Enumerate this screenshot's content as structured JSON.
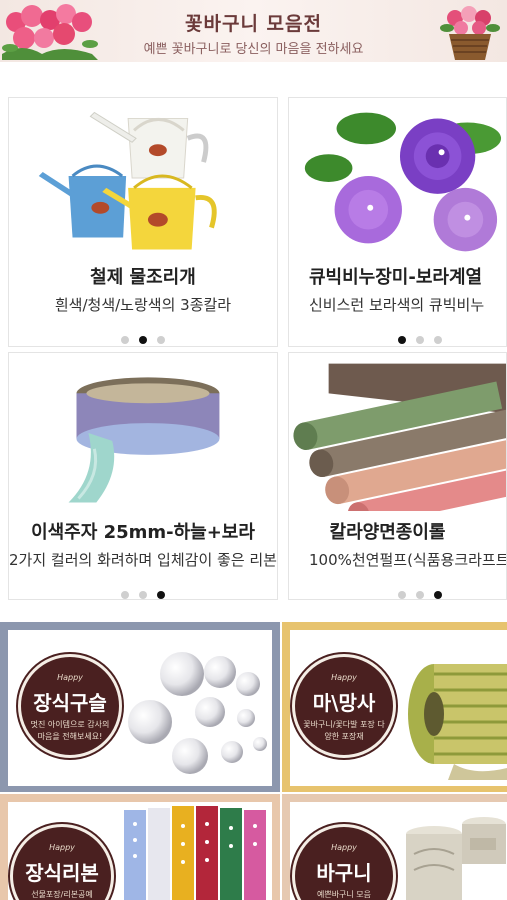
{
  "banner": {
    "title": "꽃바구니 모음전",
    "subtitle": "예쁜 꽃바구니로 당신의 마음을 전하세요"
  },
  "products": [
    {
      "title": "철제 물조리개",
      "desc": "흰색/청색/노랑색의 3종칼라",
      "active_dot": 2,
      "dot_count": 3
    },
    {
      "title": "큐빅비누장미-보라계열",
      "desc": "신비스런 보라색의 큐빅비누",
      "active_dot": 1,
      "dot_count": 3
    },
    {
      "title": "이색주자 25mm-하늘+보라",
      "desc": "2가지 컬러의 화려하며 입체감이 좋은 리본",
      "active_dot": 3,
      "dot_count": 3
    },
    {
      "title": "칼라양면종이롤",
      "desc": "100%천연펄프(식품용크라프트",
      "active_dot": 3,
      "dot_count": 3
    }
  ],
  "categories": [
    {
      "happy": "Happy",
      "title": "장식구슬",
      "desc": "멋진 아이템으로 감사의 마음을 전해보세요!"
    },
    {
      "happy": "Happy",
      "title": "마\\망사",
      "desc": "꽃바구니/꽃다발 포장 다양한 포장재"
    },
    {
      "happy": "Happy",
      "title": "장식리본",
      "desc": "선물포장/리본공예"
    },
    {
      "happy": "Happy",
      "title": "바구니",
      "desc": "예쁜바구니 모음"
    }
  ],
  "colors": {
    "badge": "#4a2020",
    "tile_frame_left": "#8c97ae",
    "tile_frame_right": "#e7c36e",
    "tile_frame_bottom_left": "#e8c7ab",
    "tile_frame_bottom_right": "#e6c9b1"
  }
}
